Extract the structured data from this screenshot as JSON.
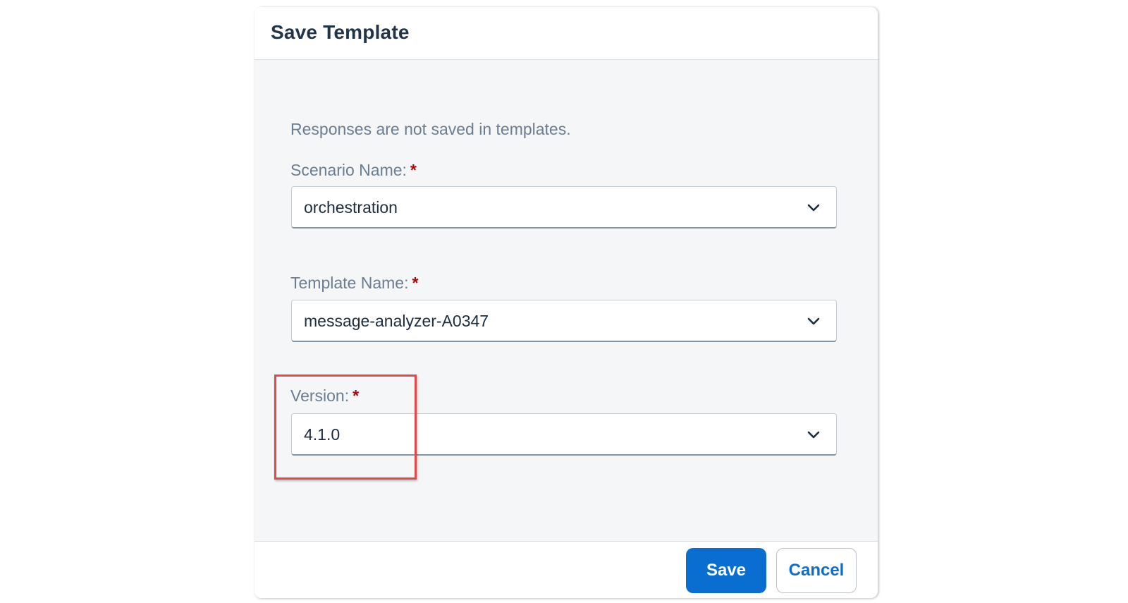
{
  "dialog": {
    "title": "Save Template",
    "info": "Responses are not saved in templates."
  },
  "fields": {
    "scenario": {
      "label": "Scenario Name:",
      "required_mark": "*",
      "value": "orchestration"
    },
    "template": {
      "label": "Template Name:",
      "required_mark": "*",
      "value": "message-analyzer-A0347"
    },
    "version": {
      "label": "Version:",
      "required_mark": "*",
      "value": "4.1.0"
    }
  },
  "footer": {
    "save_label": "Save",
    "cancel_label": "Cancel"
  },
  "colors": {
    "accent": "#0a6ed1",
    "required": "#aa0808",
    "highlight": "#e04a4a"
  },
  "icons": {
    "dropdown": "chevron-down-icon"
  }
}
